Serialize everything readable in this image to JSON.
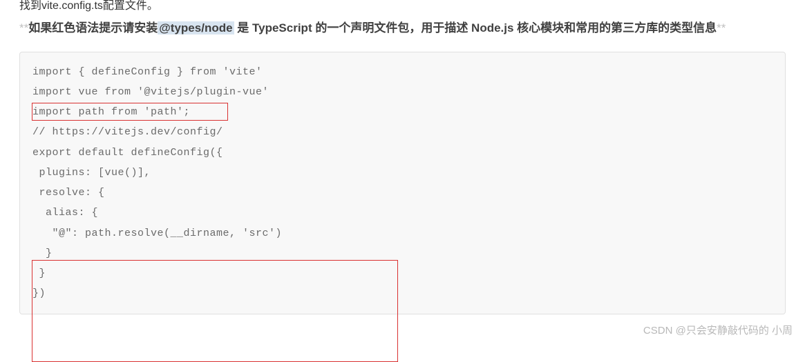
{
  "truncated_top": "找到vite.config.ts配置文件。",
  "description": {
    "stars_prefix": "**",
    "part1": "如果红色语法提示请安装",
    "highlight": "@types/node",
    "part2": " 是 TypeScript 的一个声明文件包，用于描述 Node.js 核心模块和常用的第三方库的类型信息",
    "stars_suffix": "**"
  },
  "code": {
    "lines": [
      "import { defineConfig } from 'vite'",
      "import vue from '@vitejs/plugin-vue'",
      "import path from 'path';",
      "// https://vitejs.dev/config/",
      "export default defineConfig({",
      " plugins: [vue()],",
      " resolve: {",
      "  alias: {",
      "   \"@\": path.resolve(__dirname, 'src')",
      "  }",
      " }",
      "})"
    ]
  },
  "watermark": "CSDN @只会安静敲代码的 小周"
}
